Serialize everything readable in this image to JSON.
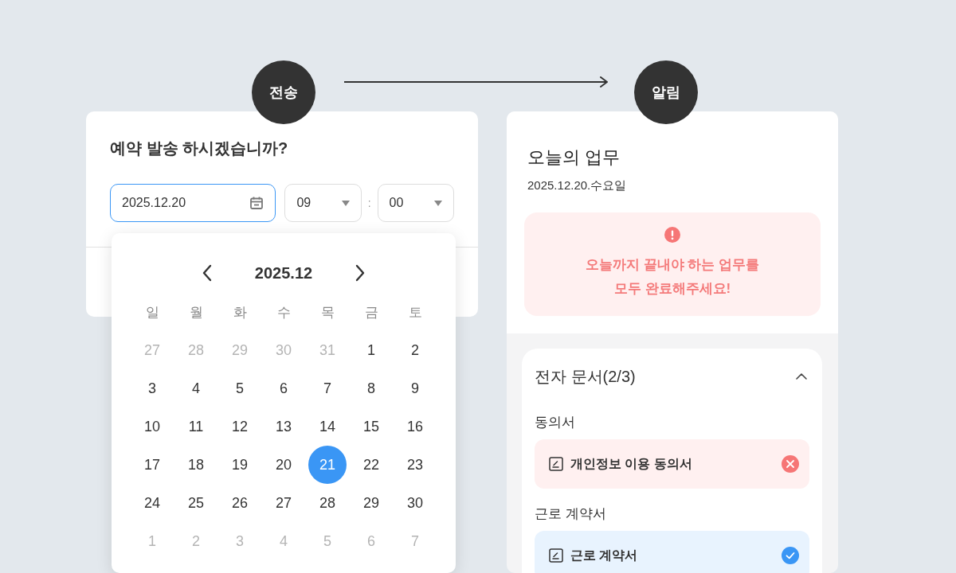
{
  "steps": [
    {
      "label": "전송"
    },
    {
      "label": "알림"
    }
  ],
  "reservation": {
    "title": "예약 발송 하시겠습니까?",
    "date_field": {
      "value": "2025.12.20"
    },
    "hour_select": {
      "value": "09"
    },
    "separator": ":",
    "minute_select": {
      "value": "00"
    }
  },
  "calendar": {
    "month": "2025.12",
    "weekdays": [
      "일",
      "월",
      "화",
      "수",
      "목",
      "금",
      "토"
    ],
    "weeks": [
      [
        {
          "day": "27",
          "outside": true,
          "selected": false
        },
        {
          "day": "28",
          "outside": true,
          "selected": false
        },
        {
          "day": "29",
          "outside": true,
          "selected": false
        },
        {
          "day": "30",
          "outside": true,
          "selected": false
        },
        {
          "day": "31",
          "outside": true,
          "selected": false
        },
        {
          "day": "1",
          "outside": false,
          "selected": false
        },
        {
          "day": "2",
          "outside": false,
          "selected": false
        }
      ],
      [
        {
          "day": "3",
          "outside": false,
          "selected": false
        },
        {
          "day": "4",
          "outside": false,
          "selected": false
        },
        {
          "day": "5",
          "outside": false,
          "selected": false
        },
        {
          "day": "6",
          "outside": false,
          "selected": false
        },
        {
          "day": "7",
          "outside": false,
          "selected": false
        },
        {
          "day": "8",
          "outside": false,
          "selected": false
        },
        {
          "day": "9",
          "outside": false,
          "selected": false
        }
      ],
      [
        {
          "day": "10",
          "outside": false,
          "selected": false
        },
        {
          "day": "11",
          "outside": false,
          "selected": false
        },
        {
          "day": "12",
          "outside": false,
          "selected": false
        },
        {
          "day": "13",
          "outside": false,
          "selected": false
        },
        {
          "day": "14",
          "outside": false,
          "selected": false
        },
        {
          "day": "15",
          "outside": false,
          "selected": false
        },
        {
          "day": "16",
          "outside": false,
          "selected": false
        }
      ],
      [
        {
          "day": "17",
          "outside": false,
          "selected": false
        },
        {
          "day": "18",
          "outside": false,
          "selected": false
        },
        {
          "day": "19",
          "outside": false,
          "selected": false
        },
        {
          "day": "20",
          "outside": false,
          "selected": false
        },
        {
          "day": "21",
          "outside": false,
          "selected": true
        },
        {
          "day": "22",
          "outside": false,
          "selected": false
        },
        {
          "day": "23",
          "outside": false,
          "selected": false
        }
      ],
      [
        {
          "day": "24",
          "outside": false,
          "selected": false
        },
        {
          "day": "25",
          "outside": false,
          "selected": false
        },
        {
          "day": "26",
          "outside": false,
          "selected": false
        },
        {
          "day": "27",
          "outside": false,
          "selected": false
        },
        {
          "day": "28",
          "outside": false,
          "selected": false
        },
        {
          "day": "29",
          "outside": false,
          "selected": false
        },
        {
          "day": "30",
          "outside": false,
          "selected": false
        }
      ],
      [
        {
          "day": "1",
          "outside": true,
          "selected": false
        },
        {
          "day": "2",
          "outside": true,
          "selected": false
        },
        {
          "day": "3",
          "outside": true,
          "selected": false
        },
        {
          "day": "4",
          "outside": true,
          "selected": false
        },
        {
          "day": "5",
          "outside": true,
          "selected": false
        },
        {
          "day": "6",
          "outside": true,
          "selected": false
        },
        {
          "day": "7",
          "outside": true,
          "selected": false
        }
      ]
    ]
  },
  "tasks": {
    "title": "오늘의 업무",
    "date": "2025.12.20.수요일",
    "alert": "오늘까지 끝내야 하는 업무를\n모두 완료해주세요!",
    "documents": {
      "title": "전자 문서(2/3)",
      "expanded": true,
      "groups": [
        {
          "label": "동의서",
          "items": [
            {
              "name": "개인정보 이용 동의서",
              "completed": false
            }
          ]
        },
        {
          "label": "근로 계약서",
          "items": [
            {
              "name": "근로 계약서",
              "completed": true
            }
          ]
        }
      ]
    }
  }
}
